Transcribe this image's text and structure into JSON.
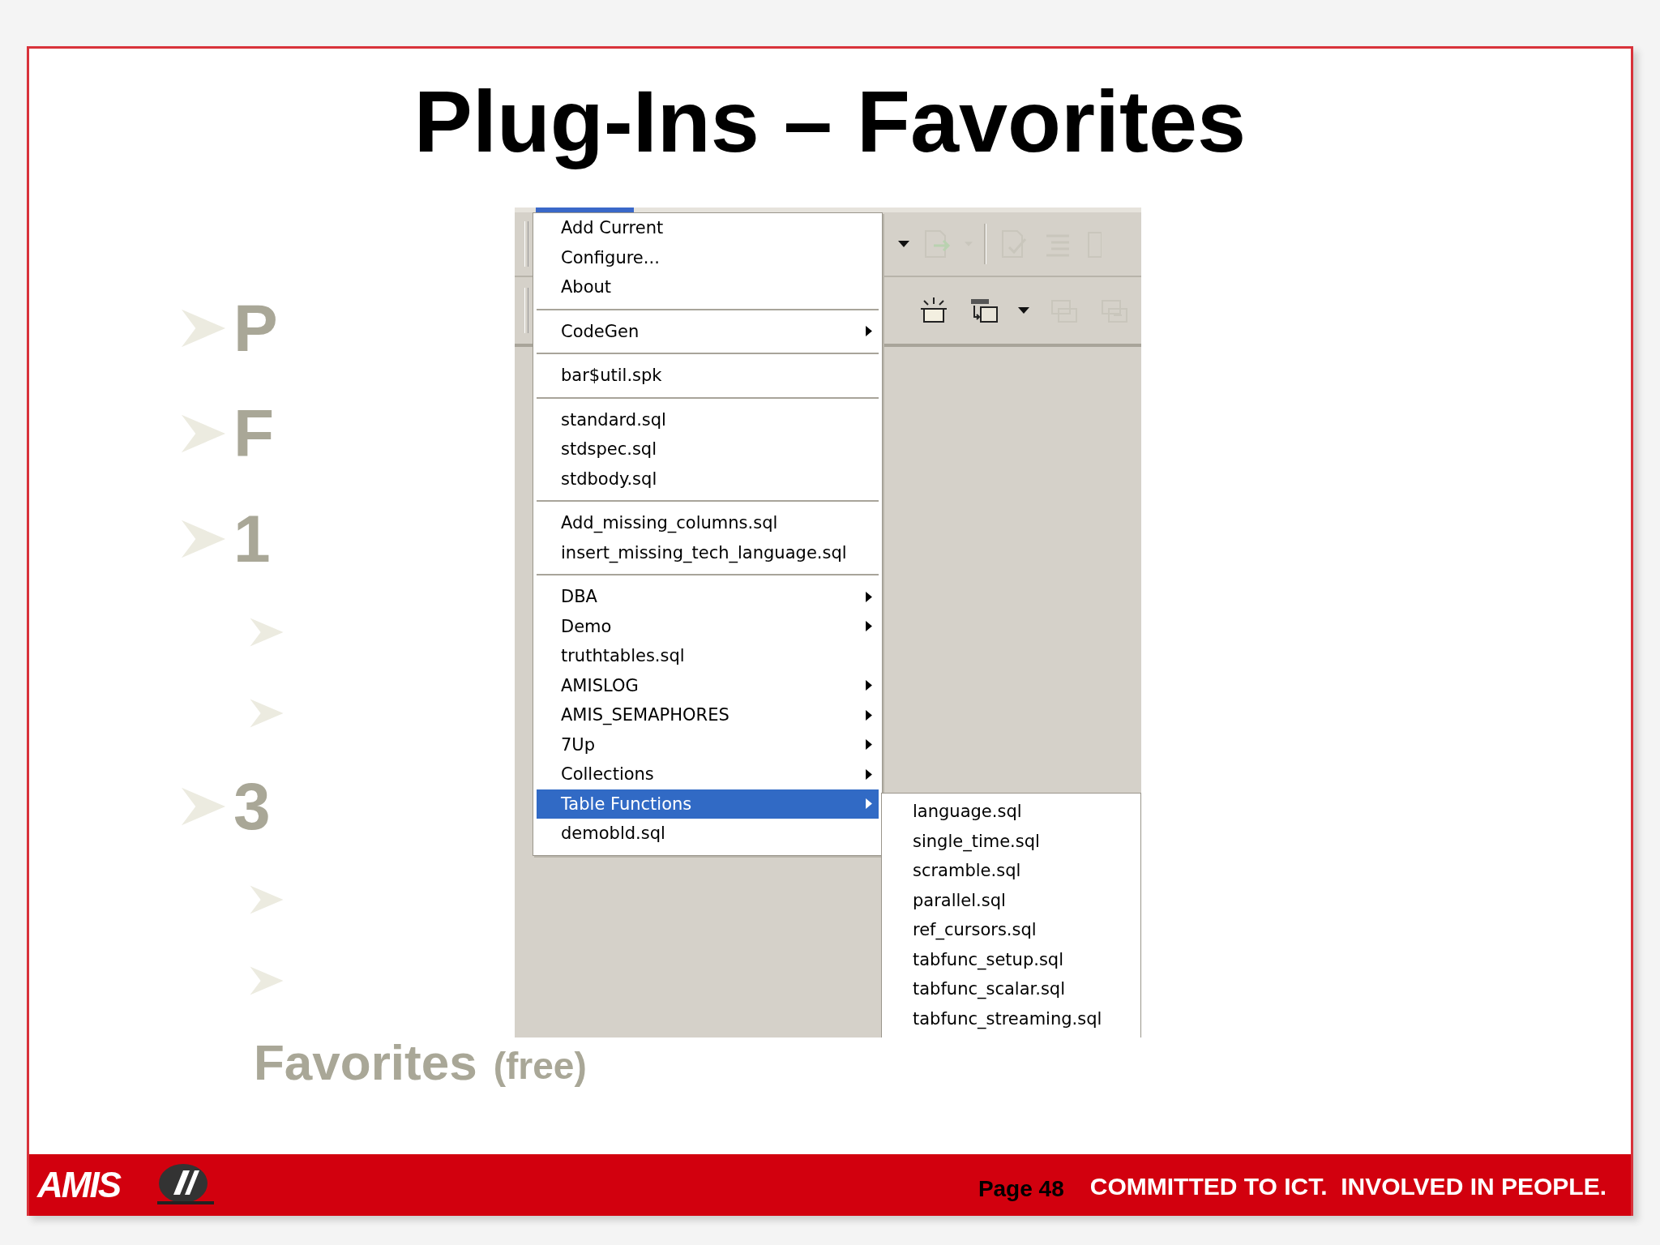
{
  "slide": {
    "title": "Plug-Ins – Favorites",
    "bullets": [
      {
        "text": "P"
      },
      {
        "text": "F"
      },
      {
        "text": "1",
        "children": [
          {
            "kind": "arrow"
          },
          {
            "kind": "arrow"
          }
        ]
      },
      {
        "text": "3",
        "children": [
          {
            "kind": "arrow"
          },
          {
            "kind": "arrow"
          },
          {
            "kind": "text",
            "text": "Favorites",
            "note": "(free)"
          }
        ]
      }
    ]
  },
  "screenshot": {
    "menu": {
      "groups": [
        [
          {
            "label": "Add Current",
            "submenu": false,
            "selected": false
          },
          {
            "label": "Configure...",
            "submenu": false,
            "selected": false
          },
          {
            "label": "About",
            "submenu": false,
            "selected": false
          }
        ],
        [
          {
            "label": "CodeGen",
            "submenu": true,
            "selected": false
          }
        ],
        [
          {
            "label": "bar$util.spk",
            "submenu": false,
            "selected": false
          }
        ],
        [
          {
            "label": "standard.sql",
            "submenu": false,
            "selected": false
          },
          {
            "label": "stdspec.sql",
            "submenu": false,
            "selected": false
          },
          {
            "label": "stdbody.sql",
            "submenu": false,
            "selected": false
          }
        ],
        [
          {
            "label": "Add_missing_columns.sql",
            "submenu": false,
            "selected": false
          },
          {
            "label": "insert_missing_tech_language.sql",
            "submenu": false,
            "selected": false
          }
        ],
        [
          {
            "label": "DBA",
            "submenu": true,
            "selected": false
          },
          {
            "label": "Demo",
            "submenu": true,
            "selected": false
          },
          {
            "label": "truthtables.sql",
            "submenu": false,
            "selected": false
          },
          {
            "label": "AMISLOG",
            "submenu": true,
            "selected": false
          },
          {
            "label": "AMIS_SEMAPHORES",
            "submenu": true,
            "selected": false
          },
          {
            "label": "7Up",
            "submenu": true,
            "selected": false
          },
          {
            "label": "Collections",
            "submenu": true,
            "selected": false
          },
          {
            "label": "Table Functions",
            "submenu": true,
            "selected": true
          },
          {
            "label": "demobld.sql",
            "submenu": false,
            "selected": false
          }
        ]
      ]
    },
    "submenu": {
      "items": [
        "language.sql",
        "single_time.sql",
        "scramble.sql",
        "parallel.sql",
        "ref_cursors.sql",
        "tabfunc_setup.sql",
        "tabfunc_scalar.sql",
        "tabfunc_streaming.sql"
      ]
    }
  },
  "footer": {
    "logo": "AMIS",
    "page": "Page 48",
    "slogan": "COMMITTED TO ICT.  INVOLVED IN PEOPLE."
  }
}
